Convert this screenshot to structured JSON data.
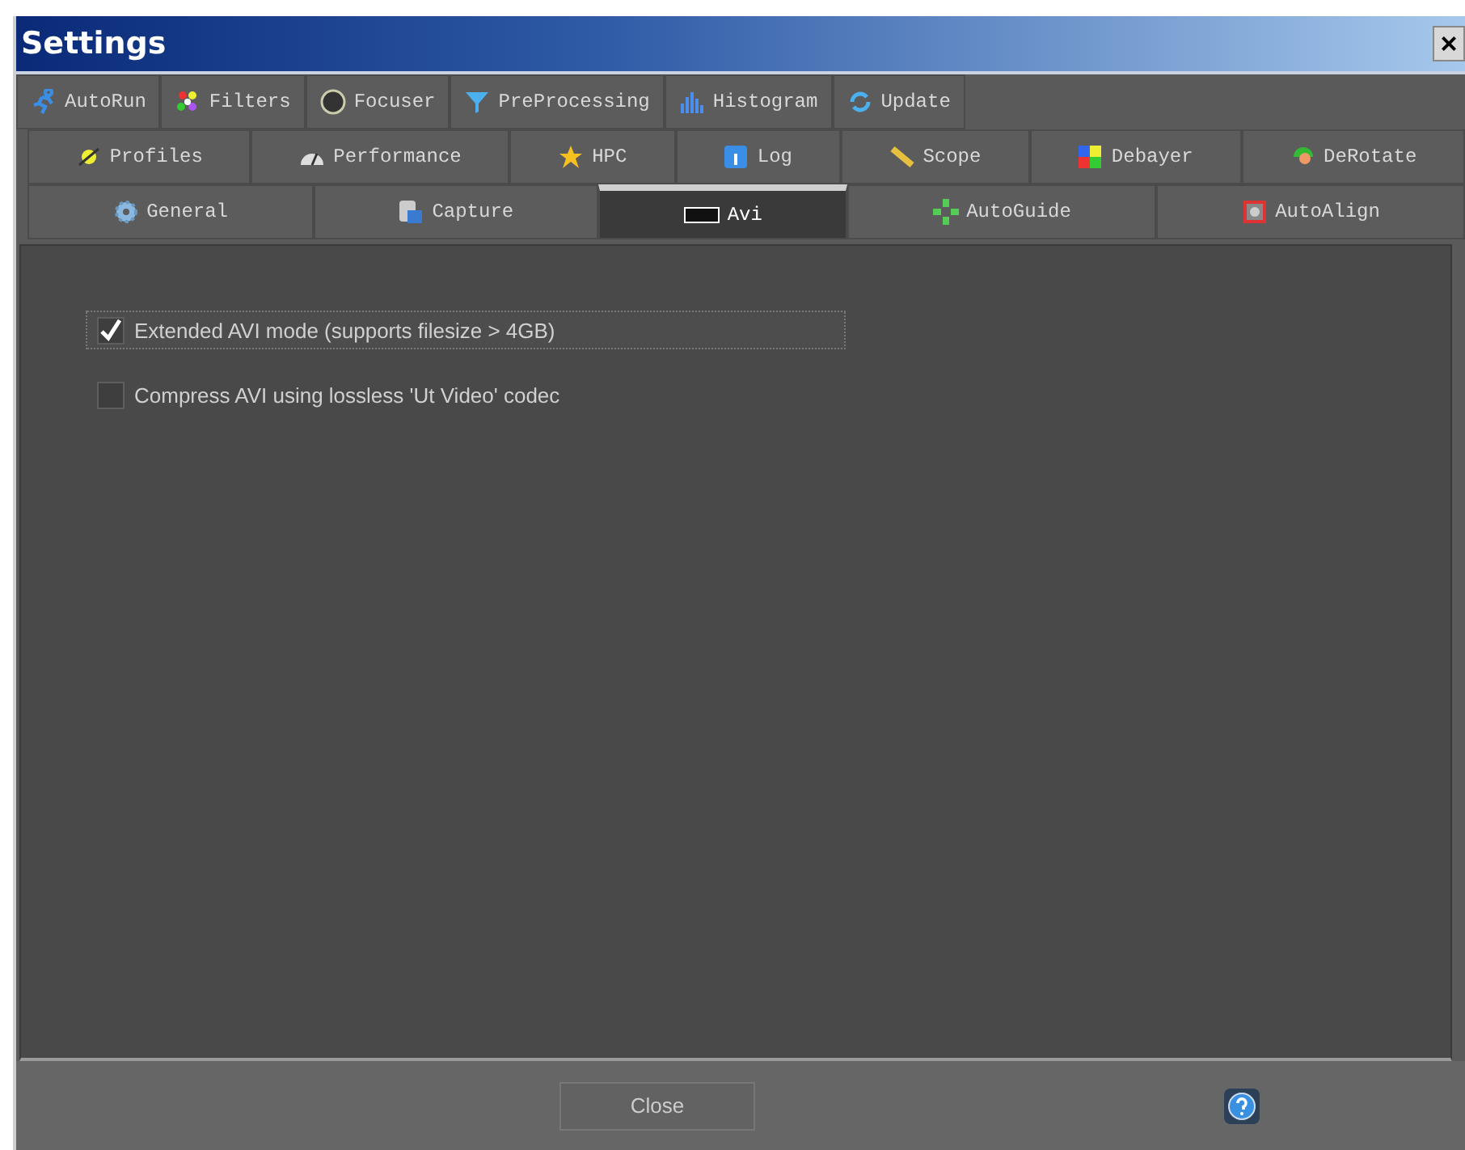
{
  "window": {
    "title": "Settings",
    "close": "×"
  },
  "tab_rows": [
    {
      "tabs": [
        {
          "label": "AutoRun",
          "selected": false
        },
        {
          "label": "Filters",
          "selected": false
        },
        {
          "label": "Focuser",
          "selected": false
        },
        {
          "label": "PreProcessing",
          "selected": false
        },
        {
          "label": "Histogram",
          "selected": false
        },
        {
          "label": "Update",
          "selected": false
        }
      ]
    },
    {
      "tabs": [
        {
          "label": "Profiles",
          "selected": false
        },
        {
          "label": "Performance",
          "selected": false
        },
        {
          "label": "HPC",
          "selected": false
        },
        {
          "label": "Log",
          "selected": false
        },
        {
          "label": "Scope",
          "selected": false
        },
        {
          "label": "Debayer",
          "selected": false
        },
        {
          "label": "DeRotate",
          "selected": false
        }
      ]
    },
    {
      "tabs": [
        {
          "label": "General",
          "selected": false
        },
        {
          "label": "Capture",
          "selected": false
        },
        {
          "label": "Avi",
          "selected": true
        },
        {
          "label": "AutoGuide",
          "selected": false
        },
        {
          "label": "AutoAlign",
          "selected": false
        }
      ]
    }
  ],
  "options": [
    {
      "label": "Extended AVI mode (supports filesize > 4GB)",
      "checked": true,
      "focused": true
    },
    {
      "label": "Compress AVI using lossless 'Ut Video' codec",
      "checked": false,
      "focused": false
    }
  ],
  "footer": {
    "close_button": "Close"
  }
}
